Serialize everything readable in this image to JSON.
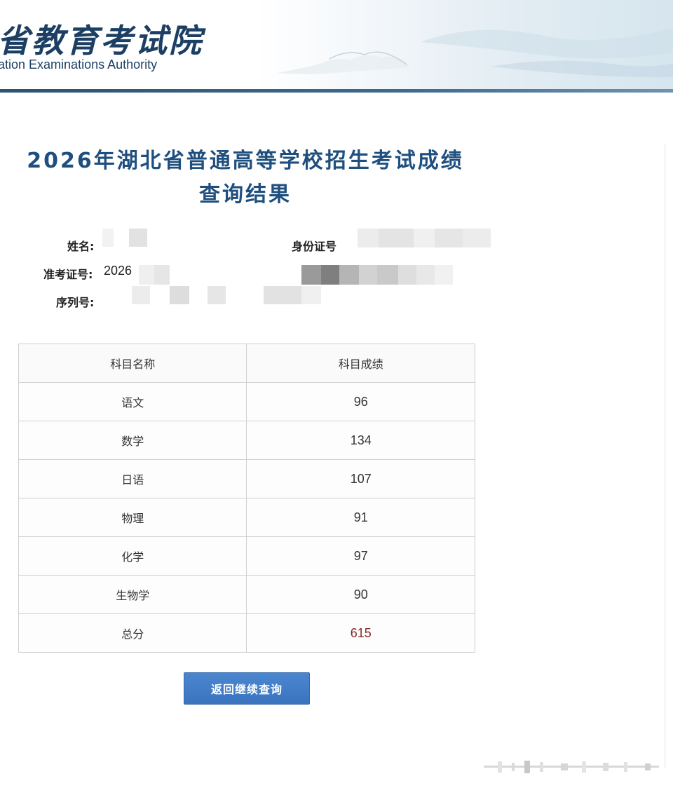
{
  "header": {
    "site_title": "省教育考试院",
    "site_subtitle": "ation Examinations Authority"
  },
  "heading": {
    "line1": "2026年湖北省普通高等学校招生考试成绩",
    "line2": "查询结果"
  },
  "candidate": {
    "name_label": "姓名:",
    "id_card_label": "身份证号",
    "exam_number_label": "准考证号:",
    "exam_number_value": "2026",
    "serial_label": "序列号:"
  },
  "score_table": {
    "headers": [
      "科目名称",
      "科目成绩"
    ],
    "rows": [
      {
        "subject": "语文",
        "score": "96"
      },
      {
        "subject": "数学",
        "score": "134"
      },
      {
        "subject": "日语",
        "score": "107"
      },
      {
        "subject": "物理",
        "score": "91"
      },
      {
        "subject": "化学",
        "score": "97"
      },
      {
        "subject": "生物学",
        "score": "90"
      },
      {
        "subject": "总分",
        "score": "615"
      }
    ]
  },
  "actions": {
    "back_label": "返回继续查询"
  },
  "colors": {
    "heading": "#1f4f7e",
    "site_title": "#1c3f63",
    "button": "#3a74c0",
    "total_score": "#8b2a2a"
  }
}
